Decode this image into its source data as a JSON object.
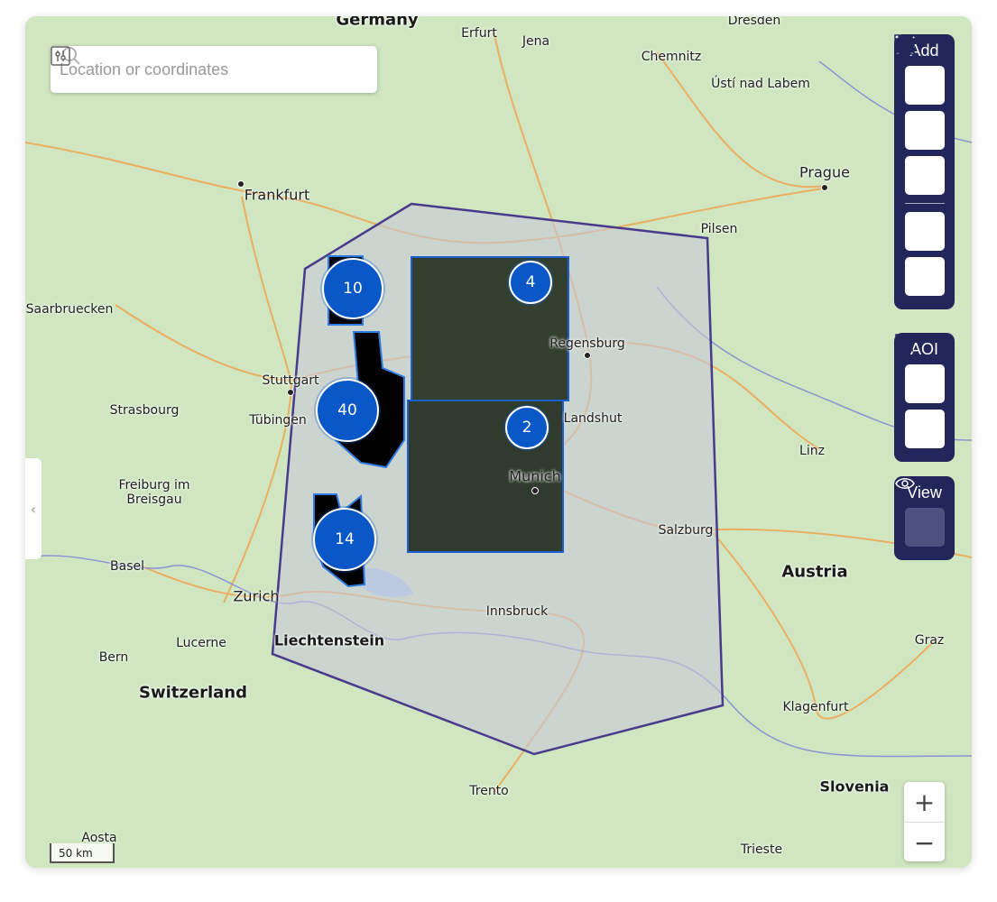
{
  "search": {
    "placeholder": "Location or coordinates",
    "value": ""
  },
  "toolbar": {
    "add_title": "Add",
    "add_items": [
      "polygon-icon",
      "rectangle-icon",
      "pin-icon",
      "upload-icon",
      "book-icon"
    ],
    "aoi_title": "AOI",
    "aoi_items": [
      "save-icon",
      "trash-icon"
    ],
    "view_title": "View",
    "view_items": [
      "eye-icon"
    ]
  },
  "zoom": {
    "in": "+",
    "out": "−"
  },
  "scale": {
    "label": "50 km"
  },
  "clusters": [
    "10",
    "40",
    "14",
    "4",
    "2"
  ],
  "labels": {
    "countries": [
      "Germany",
      "Austria",
      "Liechtenstein",
      "Switzerland",
      "Slovenia"
    ],
    "cities": [
      "Erfurt",
      "Jena",
      "Dresden",
      "Chemnitz",
      "Ústí nad Labem",
      "Prague",
      "Frankfurt",
      "Pilsen",
      "Saarbruecken",
      "Regensburg",
      "Stuttgart",
      "Strasbourg",
      "Tübingen",
      "Landshut",
      "Freiburg im Breisgau",
      "Munich",
      "Linz",
      "Salzburg",
      "Basel",
      "Zurich",
      "Innsbruck",
      "Lucerne",
      "Graz",
      "Bern",
      "Klagenfurt",
      "Trento",
      "Aosta",
      "Trieste"
    ]
  },
  "colors": {
    "aoi_outline": "#4a3a8c",
    "cluster": "#0a58c8",
    "panel": "#22265a",
    "land": "#cfe6c0"
  }
}
